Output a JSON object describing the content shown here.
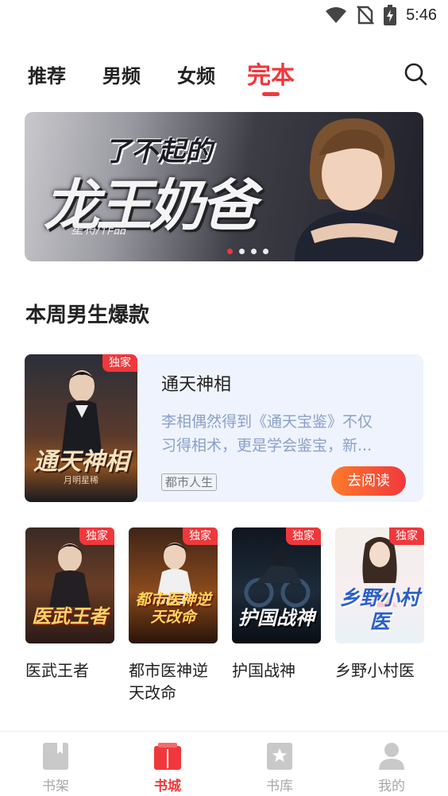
{
  "status_bar": {
    "time": "5:46"
  },
  "tabs": [
    {
      "label": "推荐"
    },
    {
      "label": "男频"
    },
    {
      "label": "女频"
    },
    {
      "label": "完本"
    }
  ],
  "banner": {
    "title_small": "了不起的",
    "title_big": "龙王奶爸",
    "author": "星将/作品",
    "slide_count": 4,
    "active_slide": 1
  },
  "section": {
    "title": "本周男生爆款"
  },
  "featured_book": {
    "badge": "独家",
    "cover_title": "通天神相",
    "cover_author": "月明星稀",
    "title": "通天神相",
    "description_line1": "李相偶然得到《通天宝鉴》不仅",
    "description_line2": "习得相术，更是学会鉴宝，新...",
    "tag": "都市人生",
    "read_button": "去阅读"
  },
  "books": [
    {
      "badge": "独家",
      "cover_title": "医武王者",
      "title": "医武王者"
    },
    {
      "badge": "独家",
      "cover_title": "都市医神逆天改命",
      "title": "都市医神逆天改命"
    },
    {
      "badge": "独家",
      "cover_title": "护国战神",
      "title": "护国战神"
    },
    {
      "badge": "独家",
      "cover_title": "乡野小村医",
      "title": "乡野小村医"
    }
  ],
  "bottom_nav": [
    {
      "label": "书架",
      "icon": "bookshelf-icon"
    },
    {
      "label": "书城",
      "icon": "bookstore-icon"
    },
    {
      "label": "书库",
      "icon": "library-icon"
    },
    {
      "label": "我的",
      "icon": "profile-icon"
    }
  ],
  "colors": {
    "accent": "#f0383c",
    "muted": "#a7a7a7",
    "card_bg": "#eef3fd"
  }
}
